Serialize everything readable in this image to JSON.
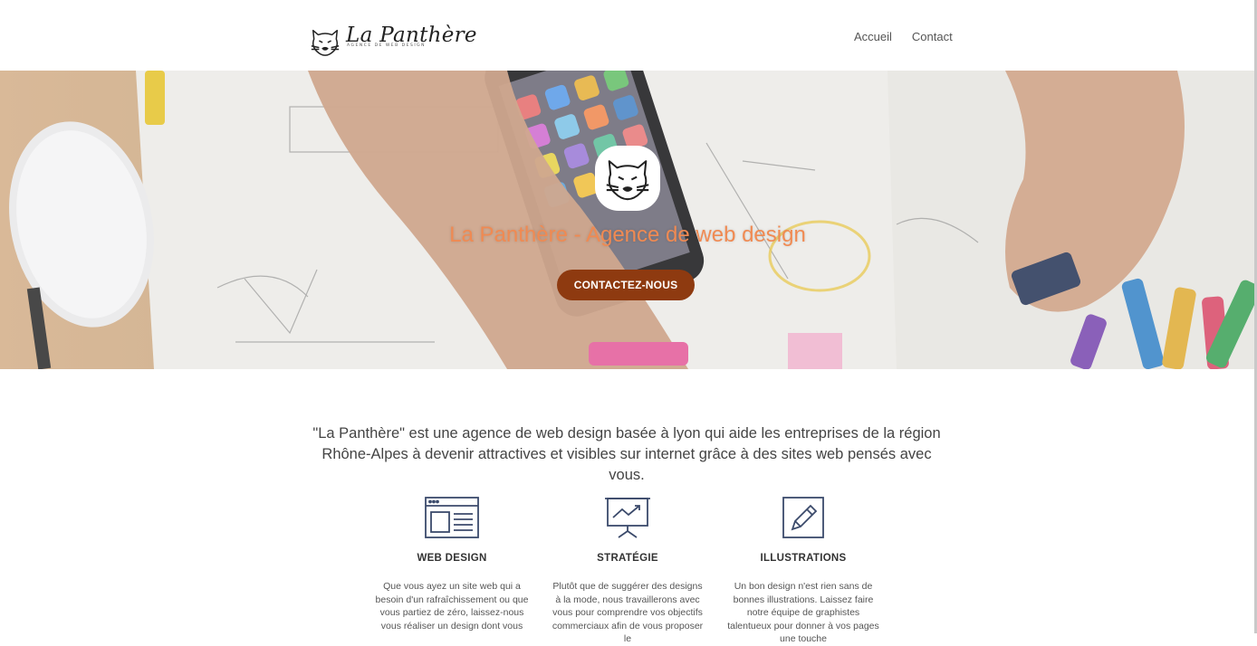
{
  "header": {
    "logo_text": "La Panthère",
    "logo_tagline": "AGENCE DE WEB DESIGN",
    "nav": [
      "Accueil",
      "Contact"
    ]
  },
  "hero": {
    "title": "La Panthère - Agence de web design",
    "cta_label": "CONTACTEZ-NOUS",
    "title_color": "#f08a52",
    "cta_color": "#8e3a10"
  },
  "intro": {
    "text": "\"La Panthère\" est une agence de web design basée à lyon qui aide les entreprises de la région Rhône-Alpes à devenir attractives et visibles sur internet grâce à des sites web pensés avec vous."
  },
  "features": [
    {
      "icon": "browser-window-icon",
      "title": "WEB DESIGN",
      "text": "Que vous ayez un site web qui a besoin d'un rafraîchissement ou que vous partiez de zéro, laissez-nous vous réaliser un design dont vous"
    },
    {
      "icon": "presentation-chart-icon",
      "title": "STRATÉGIE",
      "text": "Plutôt que de suggérer des designs à la mode, nous travaillerons avec vous pour comprendre vos objectifs commerciaux afin de vous proposer le"
    },
    {
      "icon": "pencil-square-icon",
      "title": "ILLUSTRATIONS",
      "text": "Un bon design n'est rien sans de bonnes illustrations. Laissez faire notre équipe de graphistes talentueux pour donner à vos pages une touche"
    }
  ],
  "colors": {
    "icon_stroke": "#3b4a6b"
  }
}
